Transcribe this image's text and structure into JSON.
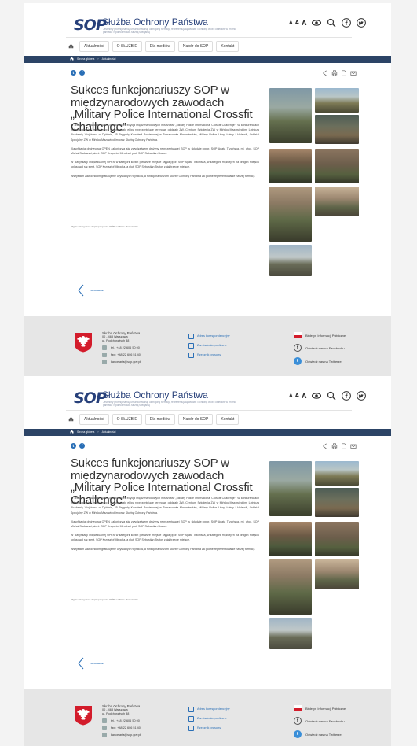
{
  "header": {
    "logo_text": "SOP",
    "brand": "Służba Ochrony Państwa",
    "tagline": "Jesteśmy profesjonalną, umundurowaną, uzbrojoną formacją reprezentującą władze i ochronę osób i obiektów w imieniu państwa i społeczeństwa służbą specjalną",
    "font_sizes": [
      "A",
      "A",
      "A"
    ]
  },
  "nav": {
    "items": [
      "Aktualności",
      "O SŁUŻBIE",
      "Dla mediów",
      "Nabór do SOP",
      "Kontakt"
    ]
  },
  "breadcrumb": [
    "Strona główna",
    "Aktualności"
  ],
  "article": {
    "title": "Sukces funkcjonariuszy SOP w międzynarodowych zawodach „Military Police International Crossfit Challenge”",
    "paragraphs": [
      "W dniach 1-3 października br. odbyła się IV edycja międzynarodowych mistrzostw „Military Police International Crossfit Challenge”. W konkurencjach indywidualnych i zespołowych wystartowały ekipy reprezentujące terenowe oddziały ŻW, Centrum Szkolenia ŻW w Mińsku Mazowieckim, Lotniczą Akademię Wojskową w Dęblinie, 25 Brygadę Kawalerii Powietrznej w Tomaszowie Mazowieckim, Military Police Litwy, Łotwy i Holandii, Oddział Specjalny ŻW w Mińsku Mazowieckim oraz Służbę Ochrony Państwa.",
      "Klasyfikacja drużynowa OPEN zakończyła się zwycięstwem drużyny reprezentującej SOP w składzie: ppor. SOP Agata Trzcińska, mł. chor. SOP Michał Sadowski, sierż. SOP Krzysztof Mirocha i plut. SOP Sebastian Bratos.",
      "W klasyfikacji indywidualnej OPEN w kategorii kobiet pierwsze miejsce zajęła ppor. SOP Agata Trzcińska, w kategorii mężczyzn na drugim miejscu uplasował się sierż. SOP Krzysztof Mirocha, a plut. SOP Sebastian Bratos zajął trzecie miejsce.",
      "Wszystkim zawodnikom gratulujemy uzyskanych wyników, a funkcjonariuszom Służby Ochrony Państwa za godne reprezentowanie naszej formacji."
    ],
    "photo_credit": "Zdjęcia udostępnione dzięki uprzejmości OSŻW w Mińsku Mazowieckim"
  },
  "prev_label": "POPRZEDNI",
  "footer": {
    "org": "Służba Ochrony Państwa",
    "address1": "00 - 463 Warszawa",
    "address2": "ul. Podchorążych 38",
    "tel": "tel.: +48 22 606 50 00",
    "fax": "fax.: +48 22 606 51 40",
    "email": "kancelaria@sop.gov.pl",
    "links": [
      "Adres korespondencyjny",
      "Zamówienia publiczne",
      "Rzecznik prasowy"
    ],
    "right": [
      "Biuletyn Informacji Publicznej",
      "Odwiedź nas na Facebooku",
      "Odwiedź nas na Twitterze"
    ]
  },
  "colors": {
    "brand": "#27407a",
    "crumbbar": "#2c4466",
    "link": "#2a6fb6",
    "footer": "#e6e6e6"
  }
}
